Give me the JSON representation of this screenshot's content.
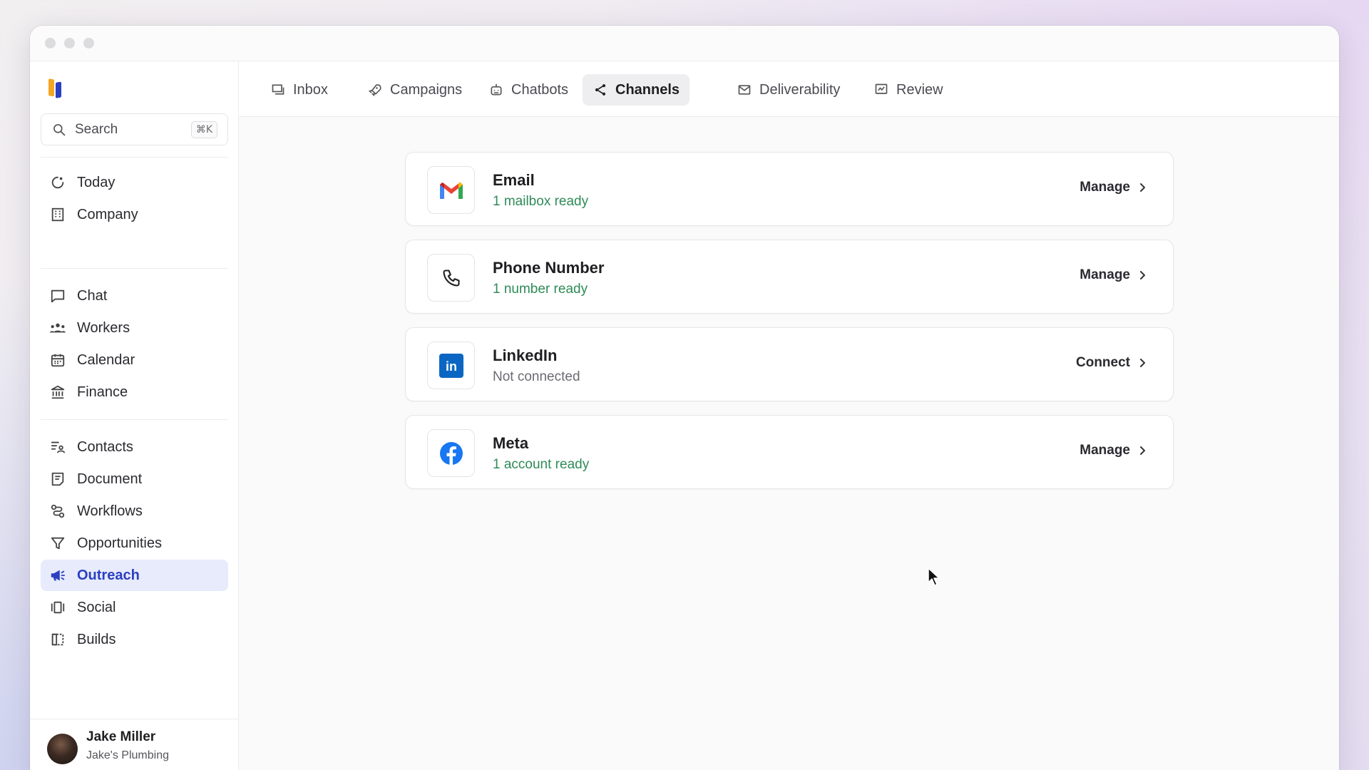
{
  "search": {
    "placeholder": "Search",
    "shortcut": "⌘K"
  },
  "sidebar": {
    "groups": [
      [
        {
          "label": "Today",
          "icon": "today-icon"
        },
        {
          "label": "Company",
          "icon": "building-icon"
        }
      ],
      [
        {
          "label": "Chat",
          "icon": "chat-icon"
        },
        {
          "label": "Workers",
          "icon": "workers-icon"
        },
        {
          "label": "Calendar",
          "icon": "calendar-icon"
        },
        {
          "label": "Finance",
          "icon": "bank-icon"
        }
      ],
      [
        {
          "label": "Contacts",
          "icon": "contacts-icon"
        },
        {
          "label": "Document",
          "icon": "document-icon"
        },
        {
          "label": "Workflows",
          "icon": "workflows-icon"
        },
        {
          "label": "Opportunities",
          "icon": "funnel-icon"
        },
        {
          "label": "Outreach",
          "icon": "megaphone-icon",
          "active": true
        },
        {
          "label": "Social",
          "icon": "social-icon"
        },
        {
          "label": "Builds",
          "icon": "builds-icon"
        }
      ]
    ]
  },
  "user": {
    "name": "Jake Miller",
    "company": "Jake's Plumbing"
  },
  "tabs": [
    {
      "label": "Inbox",
      "icon": "inbox-icon"
    },
    {
      "label": "Campaigns",
      "icon": "rocket-icon"
    },
    {
      "label": "Chatbots",
      "icon": "bot-icon"
    },
    {
      "label": "Channels",
      "icon": "share-icon",
      "active": true
    },
    {
      "label": "Deliverability",
      "icon": "mail-check-icon"
    },
    {
      "label": "Review",
      "icon": "review-icon"
    }
  ],
  "channels": [
    {
      "title": "Email",
      "status": "1 mailbox ready",
      "status_type": "ok",
      "action": "Manage",
      "icon": "gmail-icon"
    },
    {
      "title": "Phone Number",
      "status": "1 number ready",
      "status_type": "ok",
      "action": "Manage",
      "icon": "phone-icon"
    },
    {
      "title": "LinkedIn",
      "status": "Not connected",
      "status_type": "off",
      "action": "Connect",
      "icon": "linkedin-icon"
    },
    {
      "title": "Meta",
      "status": "1 account ready",
      "status_type": "ok",
      "action": "Manage",
      "icon": "facebook-icon"
    }
  ],
  "colors": {
    "accent": "#2b3fc2",
    "active_bg": "#e8ebfb",
    "status_ok": "#2e8b57",
    "linkedin": "#0a66c2",
    "facebook": "#1877f2"
  }
}
